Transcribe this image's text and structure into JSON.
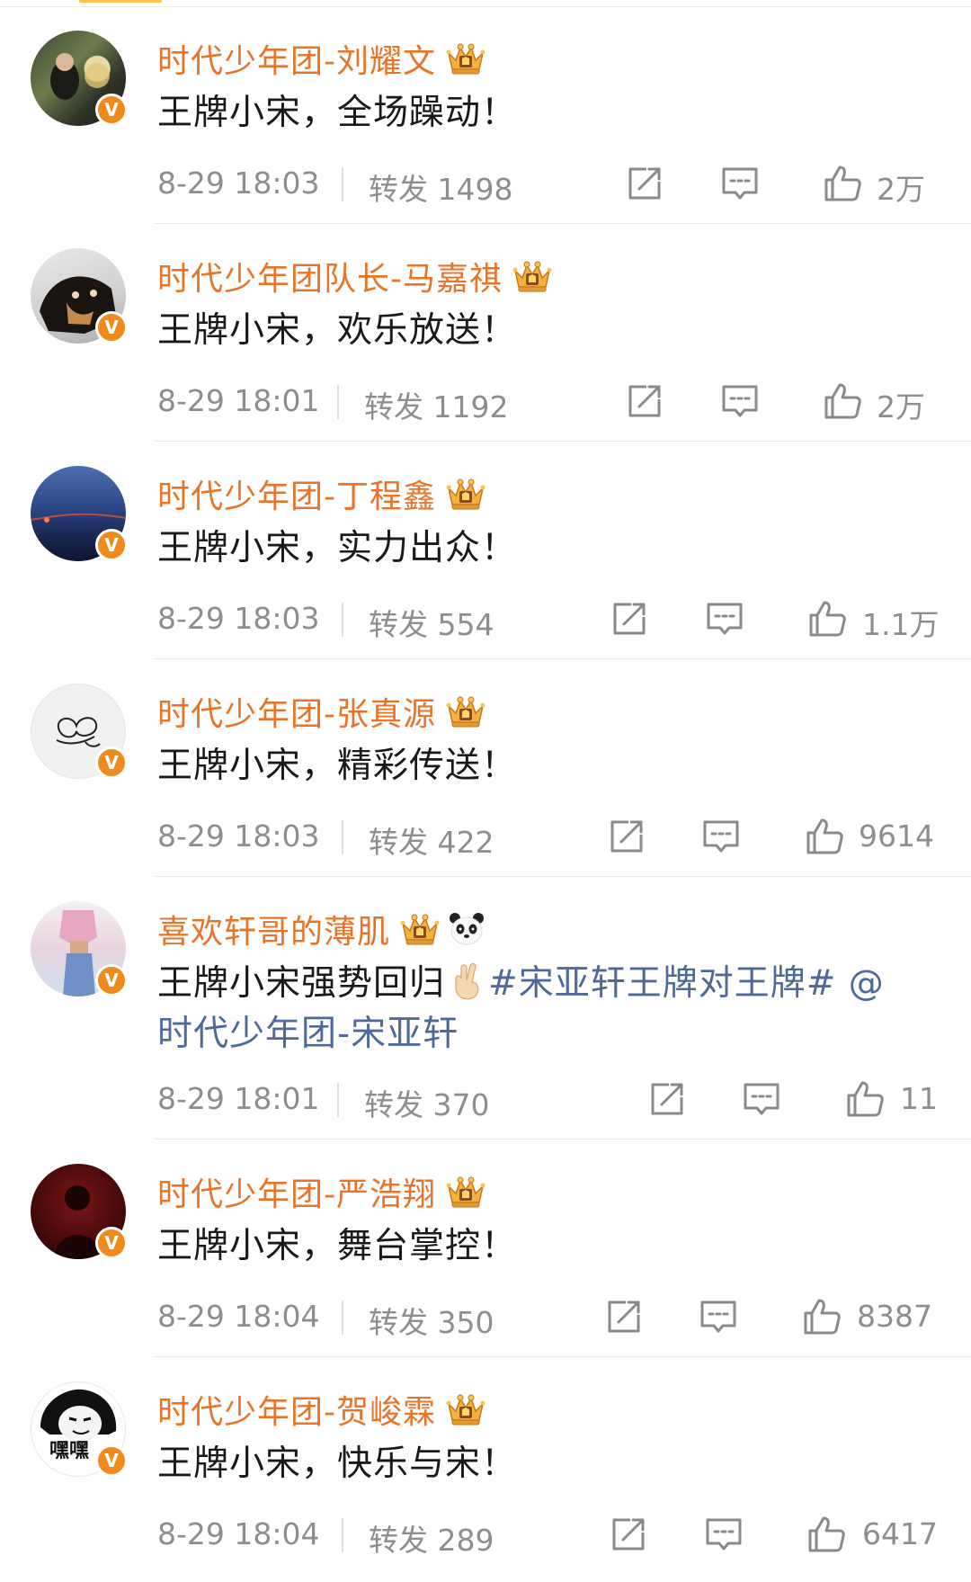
{
  "comments": [
    {
      "username": "时代少年团-刘耀文",
      "text": "王牌小宋，全场躁动！",
      "time": "8-29 18:03",
      "repost_label": "转发",
      "repost_count": "1498",
      "likes": "2万"
    },
    {
      "username": "时代少年团队长-马嘉祺",
      "text": "王牌小宋，欢乐放送！",
      "time": "8-29 18:01",
      "repost_label": "转发",
      "repost_count": "1192",
      "likes": "2万"
    },
    {
      "username": "时代少年团-丁程鑫",
      "text": "王牌小宋，实力出众！",
      "time": "8-29 18:03",
      "repost_label": "转发",
      "repost_count": "554",
      "likes": "1.1万"
    },
    {
      "username": "时代少年团-张真源",
      "text": "王牌小宋，精彩传送！",
      "time": "8-29 18:03",
      "repost_label": "转发",
      "repost_count": "422",
      "likes": "9614"
    },
    {
      "username": "喜欢轩哥的薄肌",
      "text_prefix": "王牌小宋强势回归",
      "hashtag": "#宋亚轩王牌对王牌#",
      "mention_at": "@",
      "mention": "时代少年团-宋亚轩",
      "time": "8-29 18:01",
      "repost_label": "转发",
      "repost_count": "370",
      "likes": "11"
    },
    {
      "username": "时代少年团-严浩翔",
      "text": "王牌小宋，舞台掌控！",
      "time": "8-29 18:04",
      "repost_label": "转发",
      "repost_count": "350",
      "likes": "8387"
    },
    {
      "username": "时代少年团-贺峻霖",
      "text": "王牌小宋，快乐与宋！",
      "time": "8-29 18:04",
      "repost_label": "转发",
      "repost_count": "289",
      "likes": "6417",
      "avatar_caption": "嘿嘿"
    }
  ],
  "verified_badge": "V",
  "colors": {
    "username": "#e8742a",
    "link": "#4d6a9a",
    "meta": "#8e8e8e",
    "badge": "#f08a1a"
  },
  "icons": {
    "crown": "crown-badge-icon",
    "panda": "panda-emoji-icon",
    "share": "share-icon",
    "comment": "comment-icon",
    "like": "thumbs-up-icon",
    "fingers": "crossed-fingers-emoji-icon"
  }
}
